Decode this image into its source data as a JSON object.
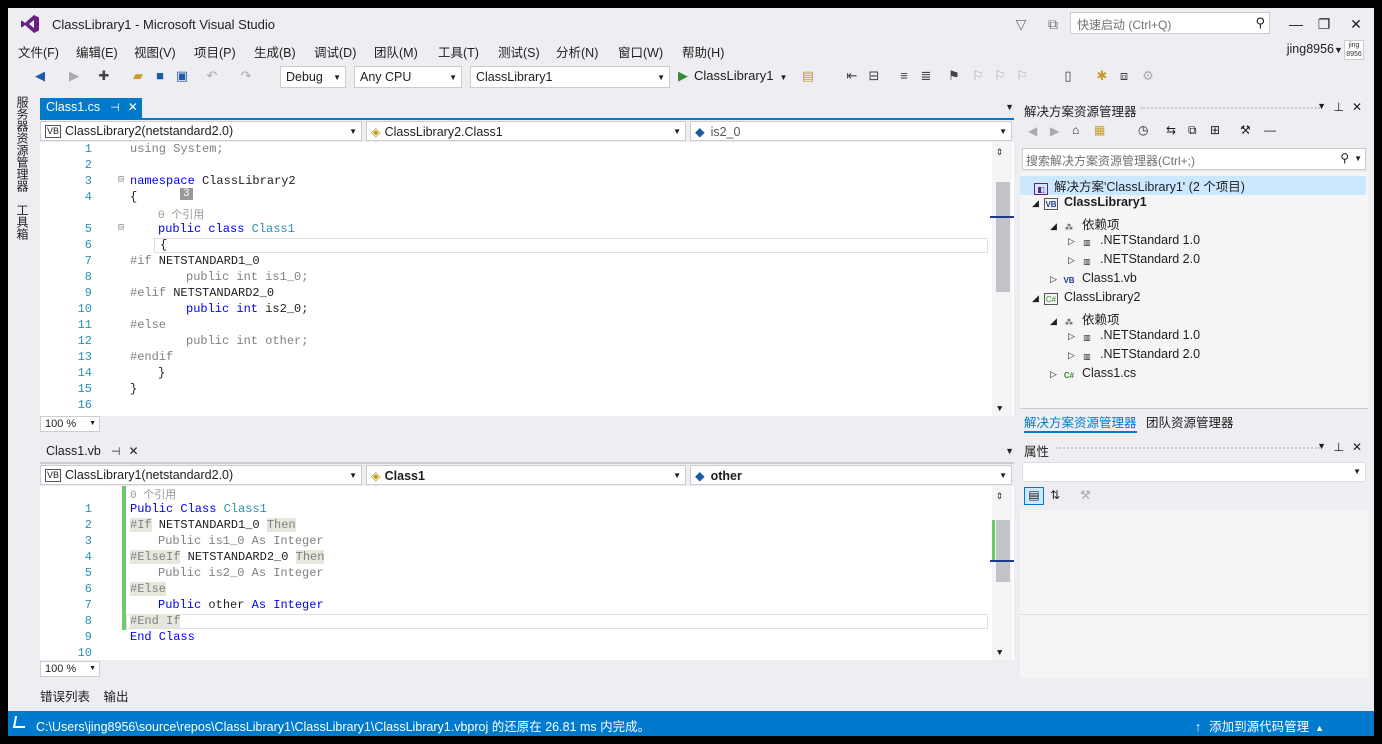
{
  "window": {
    "title": "ClassLibrary1 - Microsoft Visual Studio"
  },
  "quick_launch": {
    "placeholder": "快速启动 (Ctrl+Q)"
  },
  "menu": [
    "文件(F)",
    "编辑(E)",
    "视图(V)",
    "项目(P)",
    "生成(B)",
    "调试(D)",
    "团队(M)",
    "工具(T)",
    "测试(S)",
    "分析(N)",
    "窗口(W)",
    "帮助(H)"
  ],
  "user": {
    "name": "jing8956",
    "avatar_text": "jing\n8956"
  },
  "toolbar": {
    "config": "Debug",
    "platform": "Any CPU",
    "startup_project": "ClassLibrary1",
    "run_label": "ClassLibrary1"
  },
  "side_tabs": {
    "server": "服务器资源管理器",
    "toolbox": "工具箱"
  },
  "editor_top": {
    "tab": "Class1.cs",
    "nav": {
      "project": "ClassLibrary2(netstandard2.0)",
      "type": "ClassLibrary2.Class1",
      "member": "is2_0",
      "project_icon": "VB"
    },
    "zoom": "100 %",
    "hint": "3",
    "refs": "0 个引用",
    "lines": [
      "1",
      "2",
      "3",
      "4",
      "5",
      "6",
      "7",
      "8",
      "9",
      "10",
      "11",
      "12",
      "13",
      "14",
      "15",
      "16"
    ],
    "code": {
      "l1": "using System;",
      "l3a": "namespace",
      "l3b": " ClassLibrary2",
      "l4": "{",
      "l5a": "public class",
      "l5b": "Class1",
      "l6": "{",
      "l7a": "#if",
      "l7b": " NETSTANDARD1_0",
      "l8": "public int is1_0;",
      "l9a": "#elif",
      "l9b": " NETSTANDARD2_0",
      "l10a": "public int",
      "l10b": " is2_0;",
      "l11": "#else",
      "l12": "public int other;",
      "l13": "#endif",
      "l14": "}",
      "l15": "}"
    }
  },
  "editor_bottom": {
    "tab": "Class1.vb",
    "nav": {
      "project": "ClassLibrary1(netstandard2.0)",
      "type": "Class1",
      "member": "other",
      "project_icon": "VB"
    },
    "zoom": "100 %",
    "refs": "0 个引用",
    "lines": [
      "1",
      "2",
      "3",
      "4",
      "5",
      "6",
      "7",
      "8",
      "9",
      "10"
    ],
    "code": {
      "l1a": "Public Class",
      "l1b": "Class1",
      "l2a": "#If",
      "l2b": " NETSTANDARD1_0 ",
      "l2c": "Then",
      "l3": "Public is1_0 As Integer",
      "l4a": "#ElseIf",
      "l4b": " NETSTANDARD2_0 ",
      "l4c": "Then",
      "l5": "Public is2_0 As Integer",
      "l6": "#Else",
      "l7a": "Public",
      "l7b": " other ",
      "l7c": "As",
      "l7d": "Integer",
      "l8": "#End If",
      "l9": "End Class"
    }
  },
  "solution_explorer": {
    "title": "解决方案资源管理器",
    "search_placeholder": "搜索解决方案资源管理器(Ctrl+;)",
    "items": [
      {
        "label": "解决方案'ClassLibrary1' (2 个项目)",
        "icon": "SLN",
        "bold": false
      },
      {
        "label": "ClassLibrary1",
        "icon": "VB",
        "bold": true
      },
      {
        "label": "依赖项",
        "icon": "DEP"
      },
      {
        "label": ".NETStandard 1.0",
        "icon": "LIB"
      },
      {
        "label": ".NETStandard 2.0",
        "icon": "LIB"
      },
      {
        "label": "Class1.vb",
        "icon": "VB"
      },
      {
        "label": "ClassLibrary2",
        "icon": "C#"
      },
      {
        "label": "依赖项",
        "icon": "DEP"
      },
      {
        "label": ".NETStandard 1.0",
        "icon": "LIB"
      },
      {
        "label": ".NETStandard 2.0",
        "icon": "LIB"
      },
      {
        "label": "Class1.cs",
        "icon": "C#"
      }
    ],
    "tabs": [
      "解决方案资源管理器",
      "团队资源管理器"
    ]
  },
  "properties": {
    "title": "属性"
  },
  "bottom_tabs": [
    "错误列表",
    "输出"
  ],
  "status": {
    "message": "C:\\Users\\jing8956\\source\\repos\\ClassLibrary1\\ClassLibrary1\\ClassLibrary1.vbproj 的还原在 26.81 ms 内完成。",
    "source_control": "添加到源代码管理"
  },
  "colors": {
    "accent": "#007acc",
    "keyword": "#0000ff",
    "type": "#2b91af",
    "vs_purple": "#68217a"
  }
}
